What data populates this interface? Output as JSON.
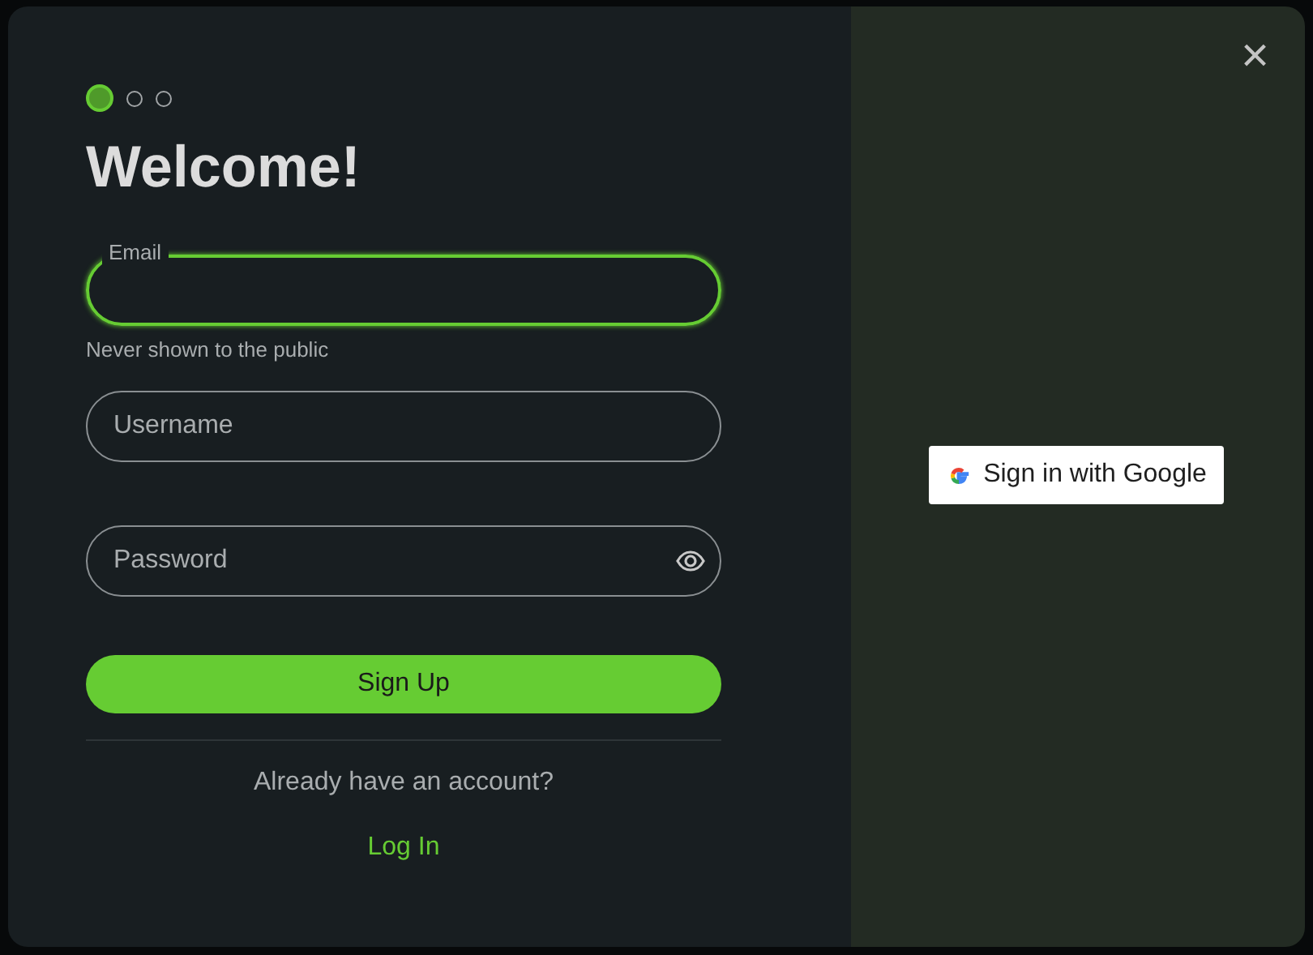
{
  "steps": [
    {
      "selected": true
    },
    {
      "selected": false
    },
    {
      "selected": false
    }
  ],
  "title": "Welcome!",
  "fields": [
    {
      "kind": "text",
      "label": "Email",
      "focused": true,
      "help": "Never shown to the public"
    },
    {
      "kind": "text",
      "placeholder": "Username",
      "focused": false
    },
    {
      "kind": "password",
      "placeholder": "Password",
      "focused": false
    }
  ],
  "submit": "Sign Up",
  "prompt": "Already have an account?",
  "login_link": "Log In",
  "google_button": "Sign in with Google",
  "close": "×"
}
